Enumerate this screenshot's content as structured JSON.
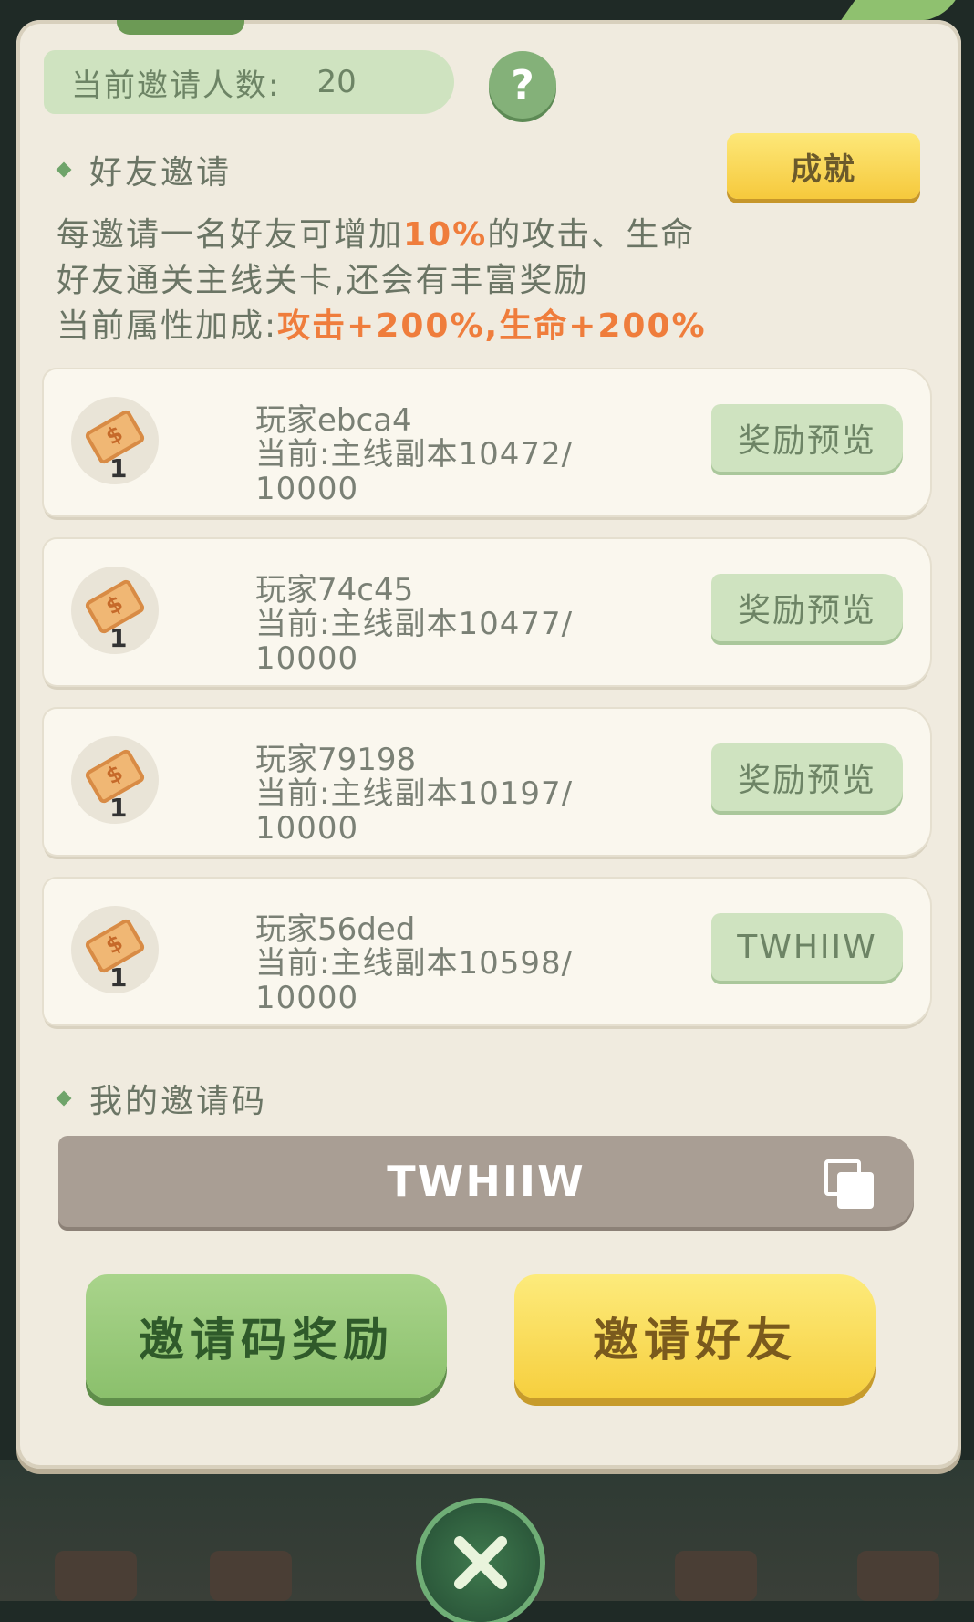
{
  "counter": {
    "label": "当前邀请人数:",
    "value": "20"
  },
  "help_label": "?",
  "friend_section": {
    "title": "好友邀请",
    "achievement_button": "成就",
    "line1_pre": "每邀请一名好友可增加",
    "line1_highlight": "10%",
    "line1_post": "的攻击、生命",
    "line2": "好友通关主线关卡,还会有丰富奖励",
    "line3_pre": "当前属性加成:",
    "line3_highlight": "攻击+200%,生命+200%"
  },
  "players": [
    {
      "name": "玩家ebca4",
      "progress_line1": "当前:主线副本10472/",
      "progress_line2": "10000",
      "reward_count": "1",
      "button": "奖励预览"
    },
    {
      "name": "玩家74c45",
      "progress_line1": "当前:主线副本10477/",
      "progress_line2": "10000",
      "reward_count": "1",
      "button": "奖励预览"
    },
    {
      "name": "玩家79198",
      "progress_line1": "当前:主线副本10197/",
      "progress_line2": "10000",
      "reward_count": "1",
      "button": "奖励预览"
    },
    {
      "name": "玩家56ded",
      "progress_line1": "当前:主线副本10598/",
      "progress_line2": "10000",
      "reward_count": "1",
      "button": "TWHIIW"
    }
  ],
  "code_section": {
    "title": "我的邀请码",
    "code": "TWHIIW"
  },
  "buttons": {
    "code_reward": "邀请码奖励",
    "invite_friend": "邀请好友"
  },
  "colors": {
    "accent_orange": "#ef7d3c",
    "green": "#8bc06c",
    "yellow": "#f6cf3e"
  }
}
